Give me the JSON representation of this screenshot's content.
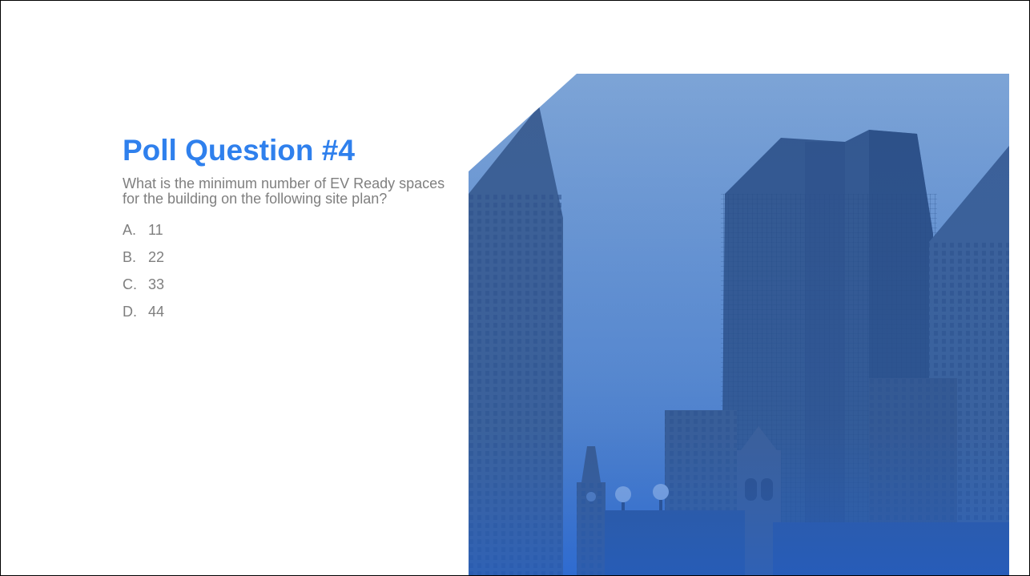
{
  "slide": {
    "title": "Poll Question #4",
    "question": "What is the minimum number of EV Ready spaces for the building on the following site plan?",
    "options": [
      {
        "letter": "A.",
        "value": "11"
      },
      {
        "letter": "B.",
        "value": "22"
      },
      {
        "letter": "C.",
        "value": "33"
      },
      {
        "letter": "D.",
        "value": "44"
      }
    ]
  },
  "colors": {
    "title": "#2f80ed",
    "body_text": "#7f7f7f",
    "photo_tint": "#3f6fb8"
  },
  "image": {
    "subject": "city-skyline-icon"
  }
}
